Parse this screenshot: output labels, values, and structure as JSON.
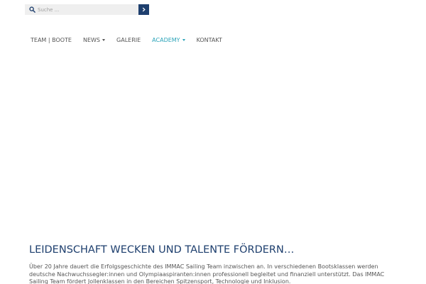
{
  "search": {
    "placeholder": "Suche ...",
    "value": ""
  },
  "nav": {
    "items": [
      {
        "label": "TEAM | BOOTE",
        "has_dropdown": false,
        "active": false
      },
      {
        "label": "NEWS",
        "has_dropdown": true,
        "active": false
      },
      {
        "label": "GALERIE",
        "has_dropdown": false,
        "active": false
      },
      {
        "label": "ACADEMY",
        "has_dropdown": true,
        "active": true
      },
      {
        "label": "KONTAKT",
        "has_dropdown": false,
        "active": false
      }
    ]
  },
  "content": {
    "headline": "LEIDENSCHAFT WECKEN UND TALENTE FÖRDERN…",
    "body": "Über 20 Jahre dauert die Erfolgsgeschichte des IMMAC Sailing Team inzwischen an. In verschiedenen Bootsklassen werden deutsche Nachwuchssegler:innen und Olympiaaspiranten:innen professionell begleitet und finanziell unterstützt. Das IMMAC Sailing Team fördert Jollenklassen in den Bereichen Spitzensport, Technologie und Inklusion."
  },
  "colors": {
    "brand_navy": "#1e3f6e",
    "accent_teal": "#2aa3b8",
    "text_gray": "#555555",
    "search_bg": "#efefef"
  },
  "icons": {
    "search": "search-icon",
    "submit": "chevron-right-icon",
    "dropdown": "caret-down-icon"
  }
}
